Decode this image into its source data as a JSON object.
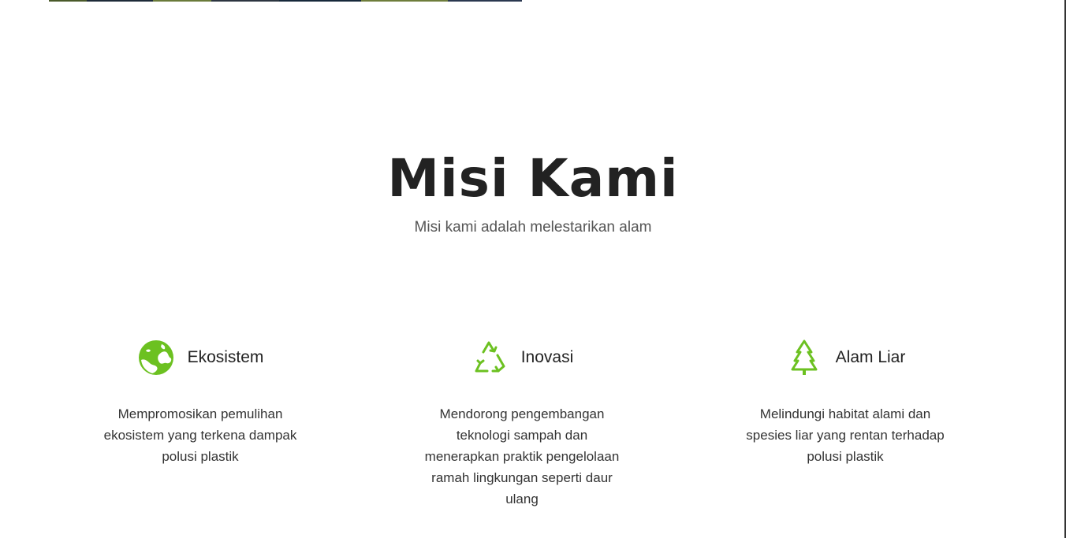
{
  "colors": {
    "accent": "#6cc121",
    "heading": "#222222",
    "subtitle": "#555555"
  },
  "mission": {
    "title": "Misi Kami",
    "subtitle": "Misi kami adalah melestarikan alam"
  },
  "features": [
    {
      "icon": "globe-icon",
      "title": "Ekosistem",
      "description": "Mempromosikan pemulihan ekosistem yang terkena dampak polusi plastik"
    },
    {
      "icon": "recycle-icon",
      "title": "Inovasi",
      "description": "Mendorong pengembangan teknologi sampah dan menerapkan praktik pengelolaan ramah lingkungan seperti daur ulang"
    },
    {
      "icon": "tree-icon",
      "title": "Alam Liar",
      "description": "Melindungi habitat alami dan spesies liar yang rentan terhadap polusi plastik"
    }
  ]
}
